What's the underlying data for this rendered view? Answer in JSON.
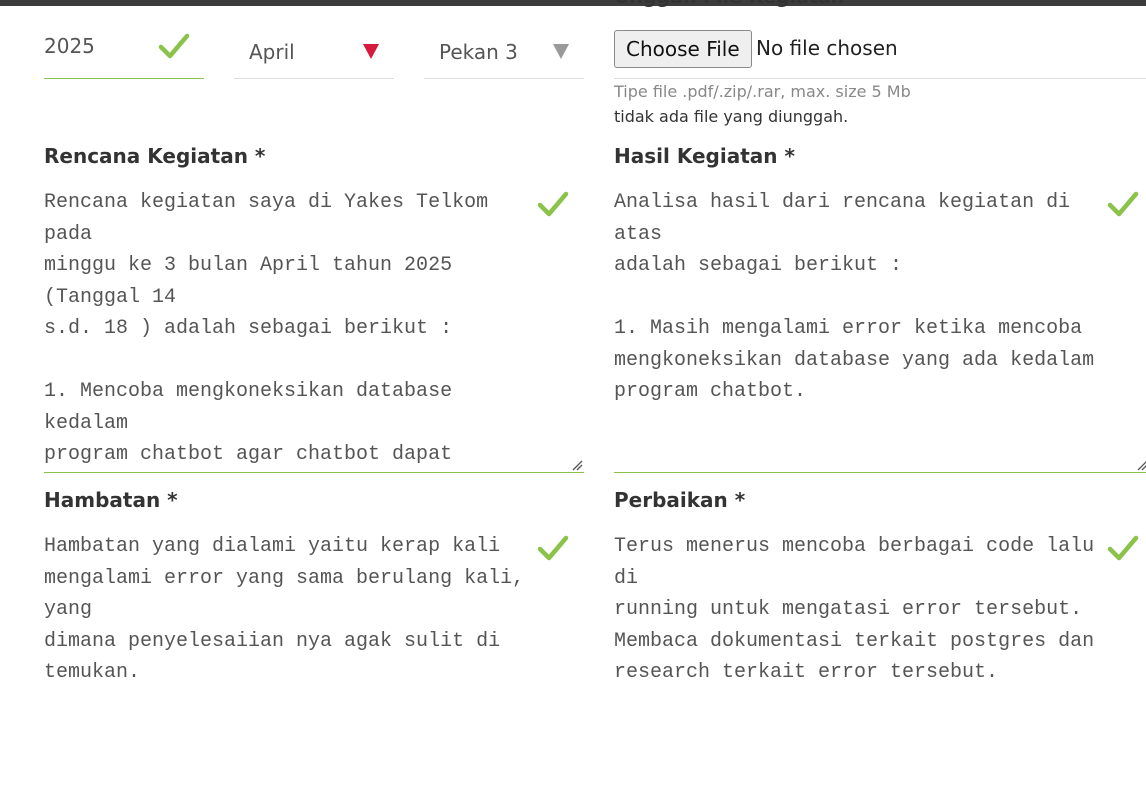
{
  "header": {
    "partial_label": "Unggah File Kegiatan"
  },
  "period": {
    "year": "2025",
    "month": "April",
    "week": "Pekan 3"
  },
  "upload": {
    "button_label": "Choose File",
    "status": "No file chosen",
    "hint": "Tipe file .pdf/.zip/.rar, max. size 5 Mb",
    "uploaded_status": "tidak ada file yang diunggah."
  },
  "fields": {
    "rencana": {
      "label": "Rencana Kegiatan *",
      "value": "Rencana kegiatan saya di Yakes Telkom pada\nminggu ke 3 bulan April tahun 2025 (Tanggal 14\ns.d. 18 ) adalah sebagai berikut :\n\n1. Mencoba mengkoneksikan database kedalam\nprogram chatbot agar chatbot dapat\nmenghasilkan jawaban berdasarkan database."
    },
    "hasil": {
      "label": "Hasil Kegiatan *",
      "value": "Analisa hasil dari rencana kegiatan di atas\nadalah sebagai berikut :\n\n1. Masih mengalami error ketika mencoba\nmengkoneksikan database yang ada kedalam\nprogram chatbot."
    },
    "hambatan": {
      "label": "Hambatan *",
      "value": "Hambatan yang dialami yaitu kerap kali\nmengalami error yang sama berulang kali, yang\ndimana penyelesaiian nya agak sulit di temukan."
    },
    "perbaikan": {
      "label": "Perbaikan *",
      "value": "Terus menerus mencoba berbagai code lalu di\nrunning untuk mengatasi error tersebut.\nMembaca dokumentasi terkait postgres dan\nresearch terkait error tersebut."
    }
  },
  "colors": {
    "valid_check": "#8bc34a",
    "error_arrow": "#d61a3c",
    "topbar": "#3c3c3c"
  },
  "icons": {
    "valid": "checkmark-icon",
    "dropdown": "triangle-down-icon",
    "resize": "resize-grip-icon"
  }
}
